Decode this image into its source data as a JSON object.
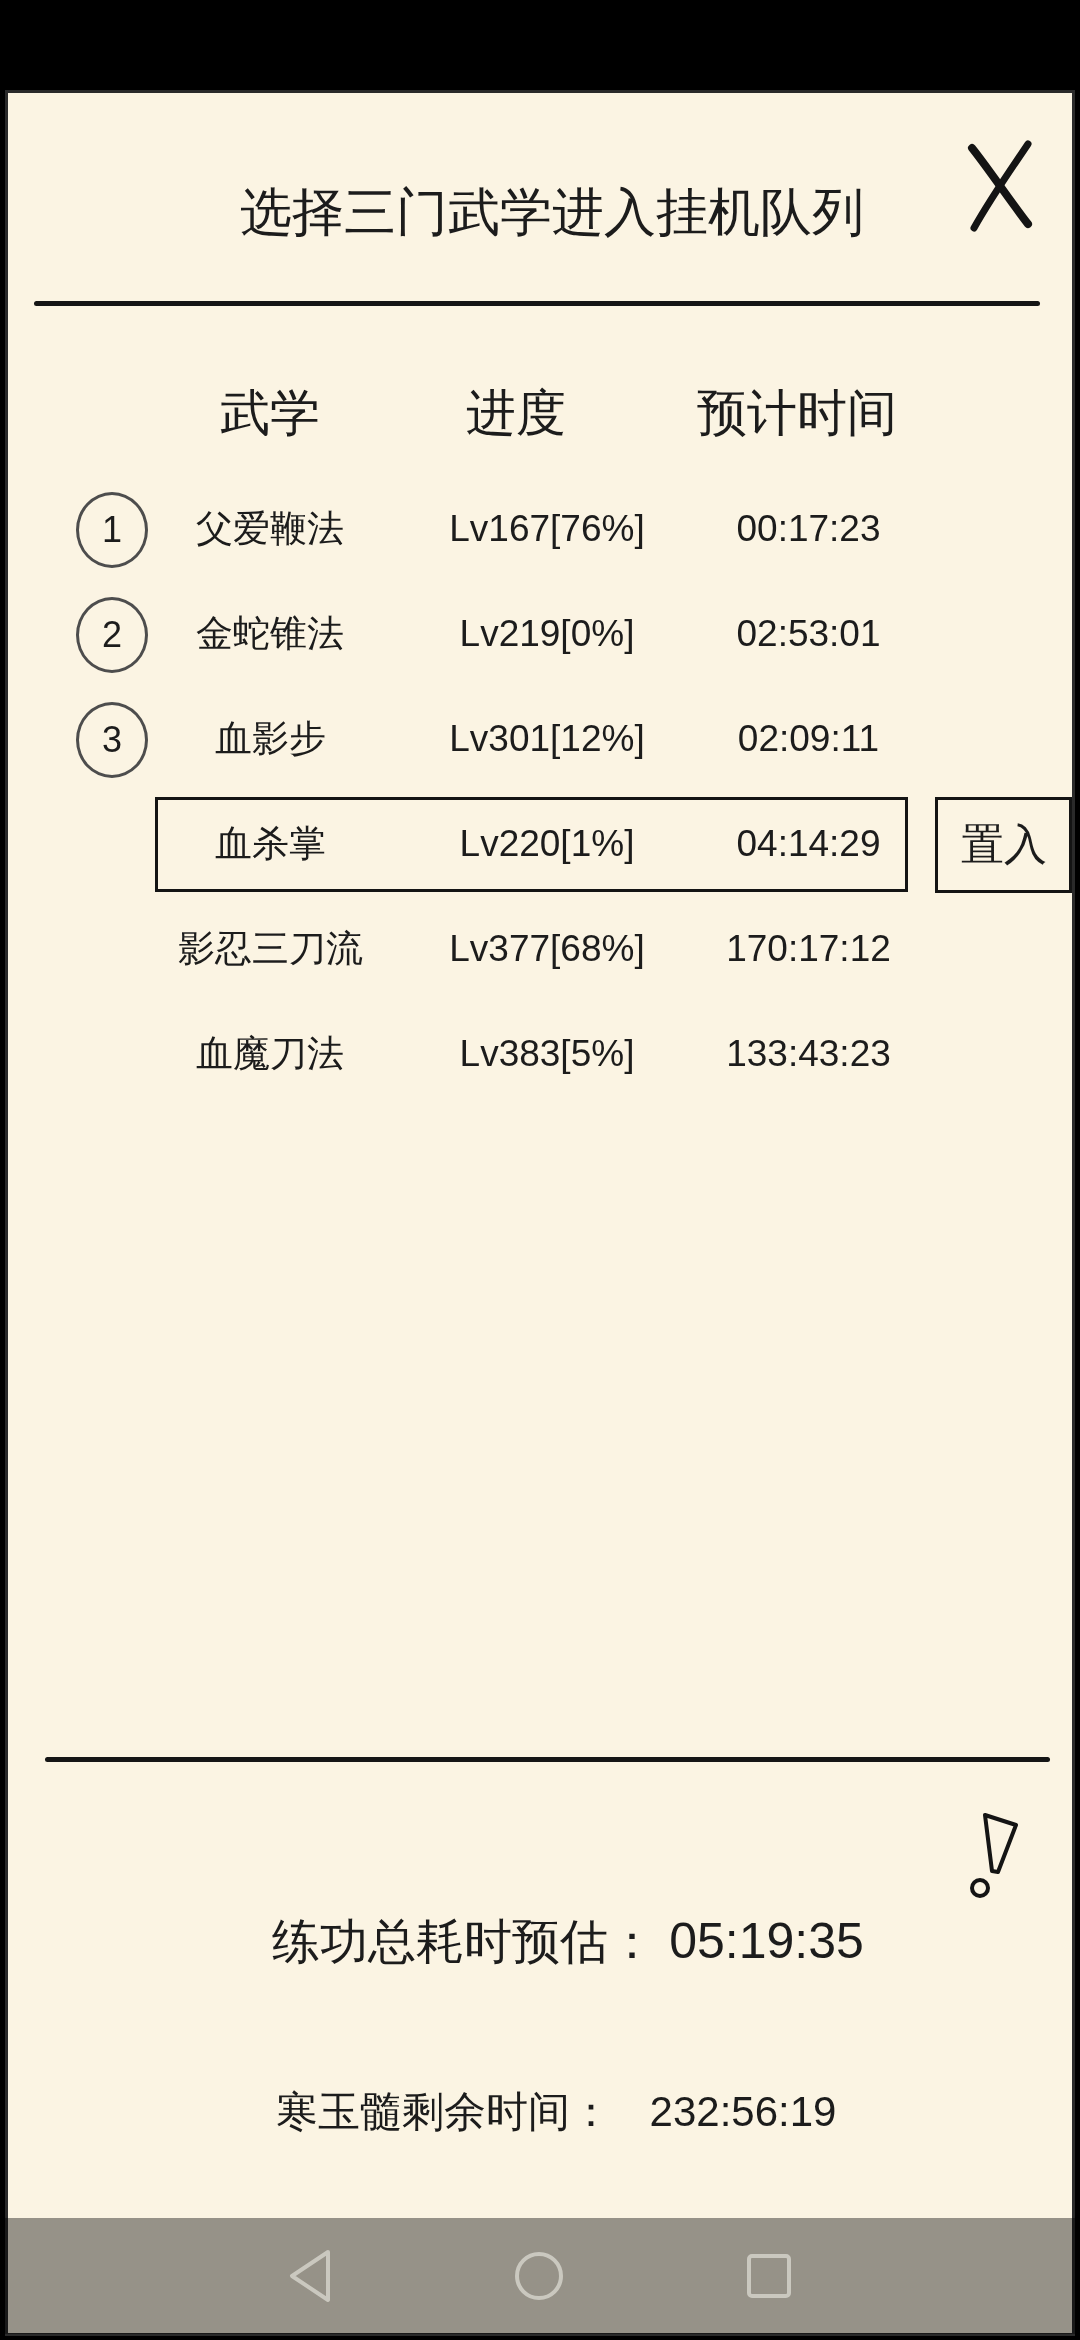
{
  "dialog": {
    "title": "选择三门武学进入挂机队列"
  },
  "table": {
    "columns": [
      "武学",
      "进度",
      "预计时间"
    ],
    "action_button": "置入",
    "rows": [
      {
        "queue_number": "1",
        "name": "父爱鞭法",
        "progress": "Lv167[76%]",
        "time": "00:17:23",
        "selected": false
      },
      {
        "queue_number": "2",
        "name": "金蛇锥法",
        "progress": "Lv219[0%]",
        "time": "02:53:01",
        "selected": false
      },
      {
        "queue_number": "3",
        "name": "血影步",
        "progress": "Lv301[12%]",
        "time": "02:09:11",
        "selected": false
      },
      {
        "name": "血杀掌",
        "progress": "Lv220[1%]",
        "time": "04:14:29",
        "selected": true
      },
      {
        "name": "影忍三刀流",
        "progress": "Lv377[68%]",
        "time": "170:17:12",
        "selected": false
      },
      {
        "name": "血魔刀法",
        "progress": "Lv383[5%]",
        "time": "133:43:23",
        "selected": false
      }
    ]
  },
  "summary": [
    {
      "kind": "total",
      "label": "练功总耗时预估：",
      "value": "05:19:35"
    },
    {
      "kind": "remaining",
      "label": "寒玉髓剩余时间：",
      "value": "232:56:19"
    }
  ]
}
